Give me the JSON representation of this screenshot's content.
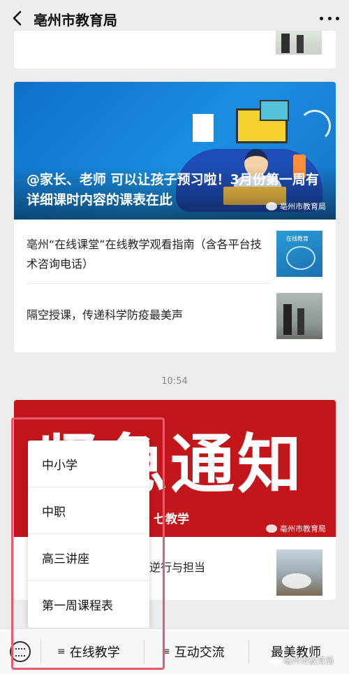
{
  "titlebar": {
    "title": "亳州市教育局"
  },
  "article_main": {
    "headline": "@家长、老师  可以让孩子预习啦！3月份第一周有详细课时内容的课表在此",
    "watermark": "亳州市教育局",
    "items": [
      {
        "title": "亳州“在线课堂”在线教学观看指南（含各平台技术咨询电话）",
        "thumb_label": "在线教育"
      },
      {
        "title": "隔空授课，传递科学防疫最美声"
      }
    ]
  },
  "timestamp": "10:54",
  "article_notice": {
    "hero_text": "紧急通知",
    "hero_sub": "七教学",
    "watermark": "亳州市教育局",
    "item_title": "逆行与担当"
  },
  "popup_menu": {
    "options": [
      "中小学",
      "中职",
      "高三讲座",
      "第一周课程表"
    ]
  },
  "bottom_bar": {
    "tabs": [
      "在线教学",
      "互动交流",
      "最美教师"
    ],
    "watermark": "亳州市教育局"
  },
  "colors": {
    "highlight": "#ea5a6e",
    "notice_red": "#c2161b",
    "hero_blue": "#1b8ee0"
  }
}
